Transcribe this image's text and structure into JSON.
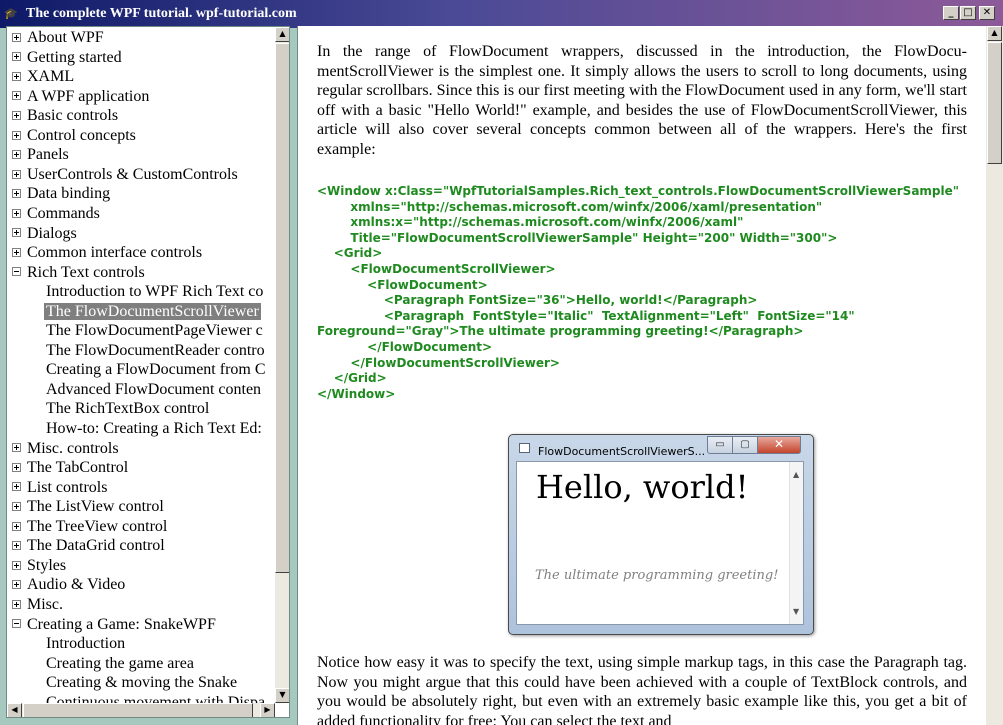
{
  "window": {
    "title": "The complete WPF tutorial. wpf-tutorial.com",
    "app_icon": "graduation-cap-icon",
    "buttons": {
      "minimize": "_",
      "maximize": "□",
      "close": "✕"
    }
  },
  "tree": {
    "items": [
      {
        "label": "About WPF",
        "expander": "plus",
        "indent": 0
      },
      {
        "label": "Getting started",
        "expander": "plus",
        "indent": 0
      },
      {
        "label": "XAML",
        "expander": "plus",
        "indent": 0
      },
      {
        "label": "A WPF application",
        "expander": "plus",
        "indent": 0
      },
      {
        "label": "Basic controls",
        "expander": "plus",
        "indent": 0
      },
      {
        "label": "Control concepts",
        "expander": "plus",
        "indent": 0
      },
      {
        "label": "Panels",
        "expander": "plus",
        "indent": 0
      },
      {
        "label": "UserControls & CustomControls",
        "expander": "plus",
        "indent": 0
      },
      {
        "label": "Data binding",
        "expander": "plus",
        "indent": 0
      },
      {
        "label": "Commands",
        "expander": "plus",
        "indent": 0
      },
      {
        "label": "Dialogs",
        "expander": "plus",
        "indent": 0
      },
      {
        "label": "Common interface controls",
        "expander": "plus",
        "indent": 0
      },
      {
        "label": "Rich Text controls",
        "expander": "minus",
        "indent": 0
      },
      {
        "label": "Introduction to WPF Rich Text co",
        "expander": "none",
        "indent": 1
      },
      {
        "label": "The FlowDocumentScrollViewer",
        "expander": "none",
        "indent": 1,
        "selected": true
      },
      {
        "label": "The FlowDocumentPageViewer c",
        "expander": "none",
        "indent": 1
      },
      {
        "label": "The FlowDocumentReader contro",
        "expander": "none",
        "indent": 1
      },
      {
        "label": "Creating a FlowDocument from C",
        "expander": "none",
        "indent": 1
      },
      {
        "label": "Advanced FlowDocument conten",
        "expander": "none",
        "indent": 1
      },
      {
        "label": "The RichTextBox control",
        "expander": "none",
        "indent": 1
      },
      {
        "label": "How-to: Creating a Rich Text Ed:",
        "expander": "none",
        "indent": 1
      },
      {
        "label": "Misc. controls",
        "expander": "plus",
        "indent": 0
      },
      {
        "label": "The TabControl",
        "expander": "plus",
        "indent": 0
      },
      {
        "label": "List controls",
        "expander": "plus",
        "indent": 0
      },
      {
        "label": "The ListView control",
        "expander": "plus",
        "indent": 0
      },
      {
        "label": "The TreeView control",
        "expander": "plus",
        "indent": 0
      },
      {
        "label": "The DataGrid control",
        "expander": "plus",
        "indent": 0
      },
      {
        "label": "Styles",
        "expander": "plus",
        "indent": 0
      },
      {
        "label": "Audio & Video",
        "expander": "plus",
        "indent": 0
      },
      {
        "label": "Misc.",
        "expander": "plus",
        "indent": 0
      },
      {
        "label": "Creating a Game: SnakeWPF",
        "expander": "minus",
        "indent": 0
      },
      {
        "label": "Introduction",
        "expander": "none",
        "indent": 1
      },
      {
        "label": "Creating the game area",
        "expander": "none",
        "indent": 1
      },
      {
        "label": "Creating & moving the Snake",
        "expander": "none",
        "indent": 1
      },
      {
        "label": "Continuous movement with Dispa",
        "expander": "none",
        "indent": 1
      }
    ]
  },
  "article": {
    "intro": "In the range of FlowDocument wrappers, discussed in the introduction, the FlowDocu­mentScrollViewer is the simplest one. It simply allows the users to scroll to long documents, using regular scrollbars. Since this is our first meeting with the FlowDocument used in any form, we'll start off with a basic \"Hello World!\" example, and besides the use of FlowDocu­mentScrollViewer, this article will also cover several concepts common between all of the wrappers. Here's the first example:",
    "code": "<Window x:Class=\"WpfTutorialSamples.Rich_text_controls.FlowDocumentScrollViewerSample\"\n        xmlns=\"http://schemas.microsoft.com/winfx/2006/xaml/presentation\"\n        xmlns:x=\"http://schemas.microsoft.com/winfx/2006/xaml\"\n        Title=\"FlowDocumentScrollViewerSample\" Height=\"200\" Width=\"300\">\n    <Grid>\n        <FlowDocumentScrollViewer>\n            <FlowDocument>\n                <Paragraph FontSize=\"36\">Hello, world!</Paragraph>\n                <Paragraph  FontStyle=\"Italic\"  TextAlignment=\"Left\"  FontSize=\"14\"  Foreground=\"Gray\">The ultimate programming greeting!</Paragraph>\n            </FlowDocument>\n        </FlowDocumentScrollViewer>\n    </Grid>\n</Window>",
    "after": "Notice how easy it was to specify the text, using simple markup tags, in this case the Paragraph tag. Now you might argue that this could have been achieved with a couple of TextBlock controls, and you would be absolutely right, but even with an extremely basic example like this, you get a bit of added functionality for free: You can select the text and"
  },
  "demo_window": {
    "title": "FlowDocumentScrollViewerS...",
    "hello": "Hello, world!",
    "greeting": "The ultimate programming greeting!",
    "min_glyph": "▭",
    "max_glyph": "▢",
    "close_glyph": "✕"
  },
  "scrollbars": {
    "up_glyph": "▲",
    "down_glyph": "▼",
    "left_glyph": "◀",
    "right_glyph": "▶"
  }
}
